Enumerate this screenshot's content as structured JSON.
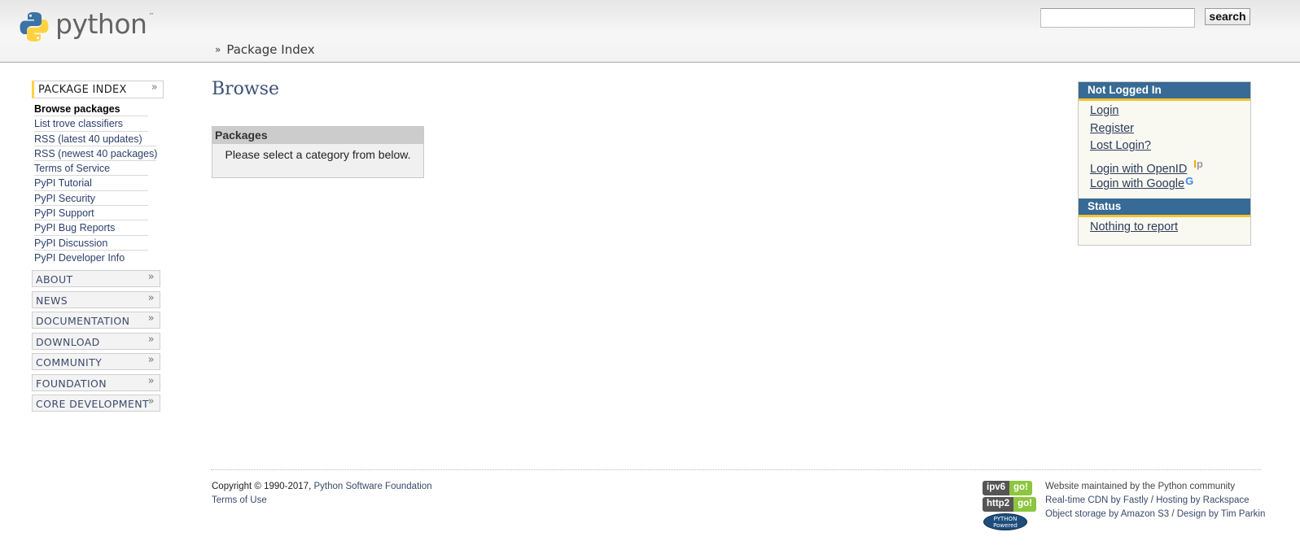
{
  "header": {
    "logo_text": "python",
    "logo_tm": "™",
    "search": {
      "value": "",
      "placeholder": "",
      "button_label": "search"
    },
    "breadcrumb": {
      "separator": "»",
      "label": "Package Index"
    }
  },
  "left_nav": {
    "active_section": {
      "label": "PACKAGE INDEX",
      "chevron": "»"
    },
    "sub_items": [
      {
        "label": "Browse packages"
      },
      {
        "label": "List trove classifiers"
      },
      {
        "label": "RSS (latest 40 updates)"
      },
      {
        "label": "RSS (newest 40 packages)"
      },
      {
        "label": "Terms of Service"
      },
      {
        "label": "PyPI Tutorial"
      },
      {
        "label": "PyPI Security"
      },
      {
        "label": "PyPI Support"
      },
      {
        "label": "PyPI Bug Reports"
      },
      {
        "label": "PyPI Discussion"
      },
      {
        "label": "PyPI Developer Info"
      }
    ],
    "sections": [
      {
        "label": "ABOUT"
      },
      {
        "label": "NEWS"
      },
      {
        "label": "DOCUMENTATION"
      },
      {
        "label": "DOWNLOAD"
      },
      {
        "label": "COMMUNITY"
      },
      {
        "label": "FOUNDATION"
      },
      {
        "label": "CORE DEVELOPMENT"
      }
    ]
  },
  "main": {
    "title": "Browse",
    "packages_box": {
      "header": "Packages",
      "body": "Please select a category from below."
    }
  },
  "right_panel": {
    "login_header": "Not Logged In",
    "login_links": [
      {
        "label": "Login"
      },
      {
        "label": "Register"
      },
      {
        "label": "Lost Login?"
      },
      {
        "label": "Login with OpenID"
      },
      {
        "label": "Login with Google"
      }
    ],
    "status_header": "Status",
    "status_text": "Nothing to report"
  },
  "footer": {
    "copyright": "Copyright © 1990-2017,",
    "psf_link": "Python Software Foundation",
    "terms": "Terms of Use",
    "badges": [
      {
        "left": "ipv6",
        "right": "go!"
      },
      {
        "left": "http2",
        "right": "go!"
      }
    ],
    "python_powered": [
      "PYTHON",
      "Powered"
    ],
    "maintained": "Website maintained by the Python community",
    "cdn_line": {
      "a": "Real-time CDN by Fastly",
      "sep": " / ",
      "b": "Hosting by Rackspace"
    },
    "storage_line": {
      "a": "Object storage by Amazon S3",
      "sep": " / ",
      "b": "Design by Tim Parkin"
    }
  },
  "colors": {
    "panel_header": "#376a94",
    "accent_yellow": "#f5c22f",
    "link": "#2b3f6b",
    "badge_green": "#8cc63e"
  }
}
